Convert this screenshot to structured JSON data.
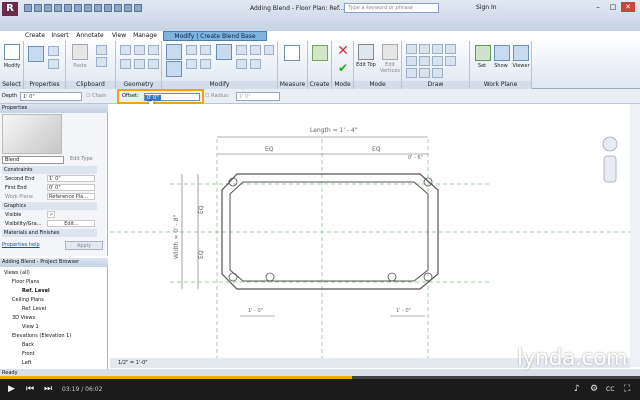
{
  "app": {
    "logo_letter": "R",
    "title": "Adding Blend - Floor Plan: Ref...",
    "search_placeholder": "Type a keyword or phrase",
    "signin": "Sign In"
  },
  "tabs": [
    {
      "label": "Create"
    },
    {
      "label": "Insert"
    },
    {
      "label": "Annotate"
    },
    {
      "label": "View"
    },
    {
      "label": "Manage"
    },
    {
      "label": "Modify | Create Blend Base Boundary"
    }
  ],
  "ribbon": {
    "panels": [
      {
        "label": "Select"
      },
      {
        "label": "Properties"
      },
      {
        "label": "Clipboard"
      },
      {
        "label": "Geometry"
      },
      {
        "label": "Modify"
      },
      {
        "label": "Measure"
      },
      {
        "label": "Create"
      },
      {
        "label": "Mode"
      },
      {
        "label": "Mode"
      },
      {
        "label": "Draw"
      },
      {
        "label": "Work Plane"
      }
    ],
    "modify_label": "Modify",
    "paste_label": "Paste",
    "edit_top_label": "Edit Top",
    "edit_vertices_label": "Edit Vertices",
    "set_label": "Set",
    "show_label": "Show",
    "viewer_label": "Viewer"
  },
  "options": {
    "depth_label": "Depth",
    "depth_value": "1' 0\"",
    "chain_label": "Chain",
    "offset_label": "Offset:",
    "offset_value": "0' 0\"",
    "radius_label": "Radius:",
    "radius_value": "1' 0\""
  },
  "properties": {
    "title": "Properties",
    "type": "Blend",
    "edit_type": "Edit Type",
    "constraints": "Constraints",
    "second_end_label": "Second End",
    "second_end_value": "1' 0\"",
    "first_end_label": "First End",
    "first_end_value": "0' 0\"",
    "work_plane_label": "Work Plane",
    "work_plane_value": "Reference Pla...",
    "graphics": "Graphics",
    "visible_label": "Visible",
    "visibility_label": "Visibility/Gra...",
    "visibility_value": "Edit...",
    "materials": "Materials and Finishes",
    "help_link": "Properties help",
    "apply": "Apply"
  },
  "browser": {
    "title": "Adding Blend - Project Browser",
    "items": [
      {
        "label": "Views (all)"
      },
      {
        "label": "Floor Plans"
      },
      {
        "label": "Ref. Level"
      },
      {
        "label": "Ceiling Plans"
      },
      {
        "label": "Ref. Level"
      },
      {
        "label": "3D Views"
      },
      {
        "label": "View 1"
      },
      {
        "label": "Elevations (Elevation 1)"
      },
      {
        "label": "Back"
      },
      {
        "label": "Front"
      },
      {
        "label": "Left"
      }
    ]
  },
  "drawing": {
    "length_dim": "Length = 1' - 4\"",
    "eq": "EQ",
    "width_dim": "Width = 0' - 8\"",
    "dim_small": "0' - 6\"",
    "dim_foot": "1' - 0\""
  },
  "viewbar": {
    "scale": "1/2\" = 1'-0\""
  },
  "status": {
    "text": "Ready"
  },
  "player": {
    "time": "03:19 / 06:02",
    "progress_fraction": 0.55,
    "watermark": "lynda.com"
  },
  "colors": {
    "accent": "#f0a500",
    "progress": "#f5a800"
  }
}
